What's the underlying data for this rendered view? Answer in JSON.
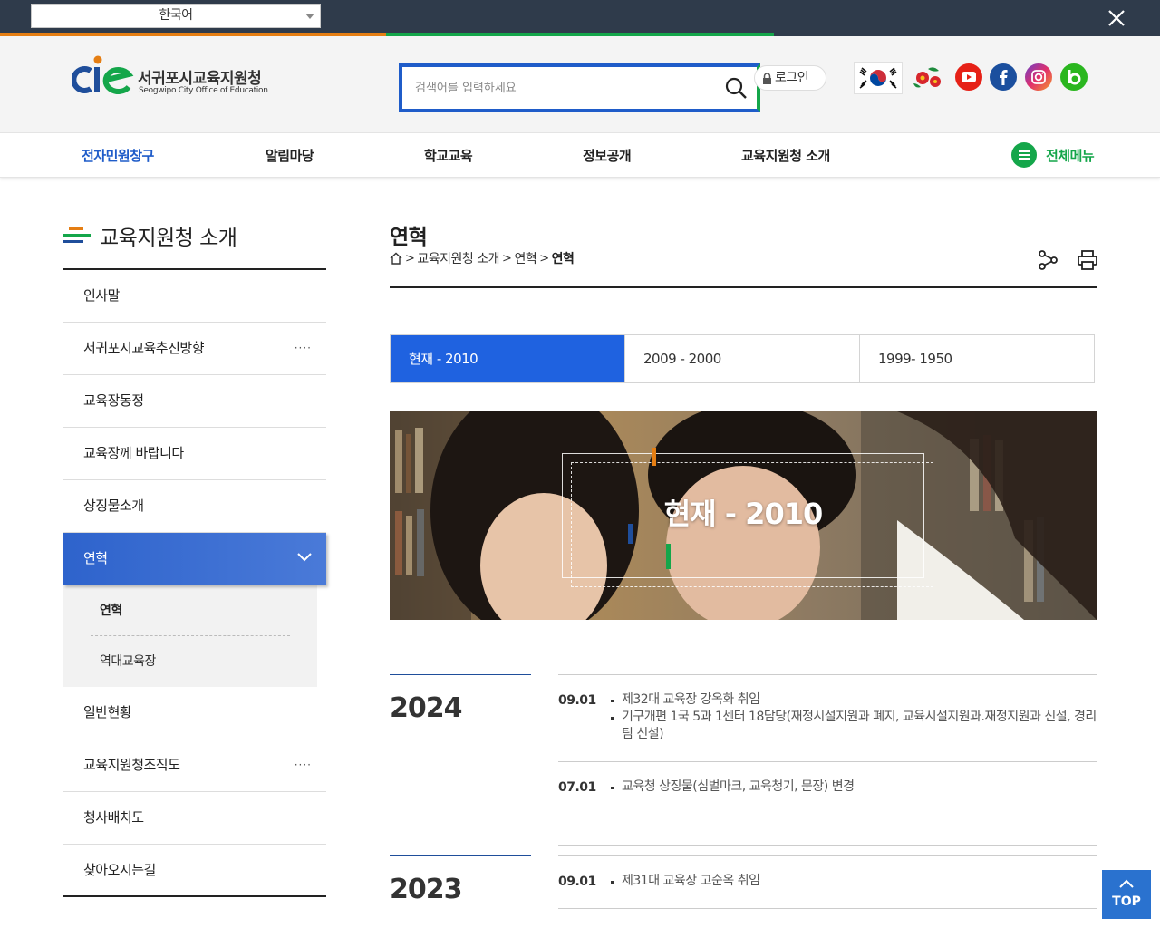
{
  "language_select": {
    "value": "한국어"
  },
  "colors": {
    "brand_blue": "#1f5cc9",
    "brand_green": "#14a64a",
    "brand_orange": "#e57e13",
    "top_bar": "#2f3b4b"
  },
  "logo": {
    "title": "서귀포시교육지원청",
    "subtitle": "Seogwipo City Office of Education"
  },
  "search": {
    "placeholder": "검색어를 입력하세요",
    "value": ""
  },
  "header": {
    "login_label": "로그인"
  },
  "sns_icons": [
    "taegukgi-icon",
    "camellia-icon",
    "youtube-icon",
    "facebook-icon",
    "instagram-icon",
    "blog-icon"
  ],
  "gnb": {
    "items": [
      "전자민원창구",
      "알림마당",
      "학교교육",
      "정보공개",
      "교육지원청 소개"
    ],
    "all_menu_label": "전체메뉴"
  },
  "sidebar": {
    "title": "교육지원청 소개",
    "items": [
      {
        "label": "인사말",
        "more": ""
      },
      {
        "label": "서귀포시교육추진방향",
        "more": "····"
      },
      {
        "label": "교육장동정",
        "more": ""
      },
      {
        "label": "교육장께 바랍니다",
        "more": ""
      },
      {
        "label": "상징물소개",
        "more": ""
      },
      {
        "label": "연혁",
        "more": ""
      },
      {
        "label": "일반현황",
        "more": ""
      },
      {
        "label": "교육지원청조직도",
        "more": "····"
      },
      {
        "label": "청사배치도",
        "more": ""
      },
      {
        "label": "찾아오시는길",
        "more": ""
      }
    ],
    "sub_items": [
      "연혁",
      "역대교육장"
    ]
  },
  "content": {
    "page_title": "연혁",
    "breadcrumb": {
      "sep": ">",
      "items": [
        "교육지원청 소개",
        "연혁"
      ],
      "current": "연혁"
    },
    "tabs": [
      "현재 - 2010",
      "2009 - 2000",
      "1999- 1950"
    ],
    "hero_text": "현재 - 2010"
  },
  "history": [
    {
      "year": "2024",
      "entries": [
        {
          "date": "09.01",
          "items": [
            "제32대 교육장 강옥화 취임",
            "기구개편 1국 5과 1센터 18담당(재정시설지원과 폐지, 교육시설지원과.재정지원과 신설, 경리팀 신설)"
          ]
        },
        {
          "date": "07.01",
          "items": [
            "교육청 상징물(심벌마크, 교육청기, 문장) 변경"
          ]
        }
      ]
    },
    {
      "year": "2023",
      "entries": [
        {
          "date": "09.01",
          "items": [
            "제31대 교육장 고순옥 취임"
          ]
        }
      ]
    }
  ],
  "top_button": {
    "label": "TOP"
  }
}
